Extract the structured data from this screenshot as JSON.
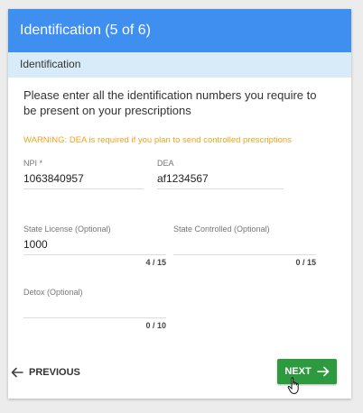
{
  "header": {
    "title": "Identification (5 of 6)"
  },
  "section": {
    "title": "Identification"
  },
  "intro_text": "Please enter all the identification numbers you require to be present on your prescriptions",
  "warning_text": "WARNING: DEA is required if you plan to send controlled prescriptions",
  "fields": {
    "npi": {
      "label": "NPI *",
      "value": "1063840957"
    },
    "dea": {
      "label": "DEA",
      "value": "af1234567"
    },
    "state_license": {
      "label": "State License (Optional)",
      "value": "1000",
      "counter": "4 / 15"
    },
    "state_controlled": {
      "label": "State Controlled (Optional)",
      "value": "",
      "counter": "0 / 15"
    },
    "detox": {
      "label": "Detox (Optional)",
      "value": "",
      "counter": "0 / 10"
    }
  },
  "nav": {
    "previous_label": "PREVIOUS",
    "next_label": "NEXT"
  },
  "colors": {
    "header_bg": "#3f8ff0",
    "subheader_bg": "#d8ebf8",
    "warning": "#f1a21f",
    "next_bg": "#2d9a3f"
  },
  "icons": {
    "previous": "arrow-left-icon",
    "next": "arrow-right-icon",
    "cursor": "hand-pointer-icon"
  }
}
